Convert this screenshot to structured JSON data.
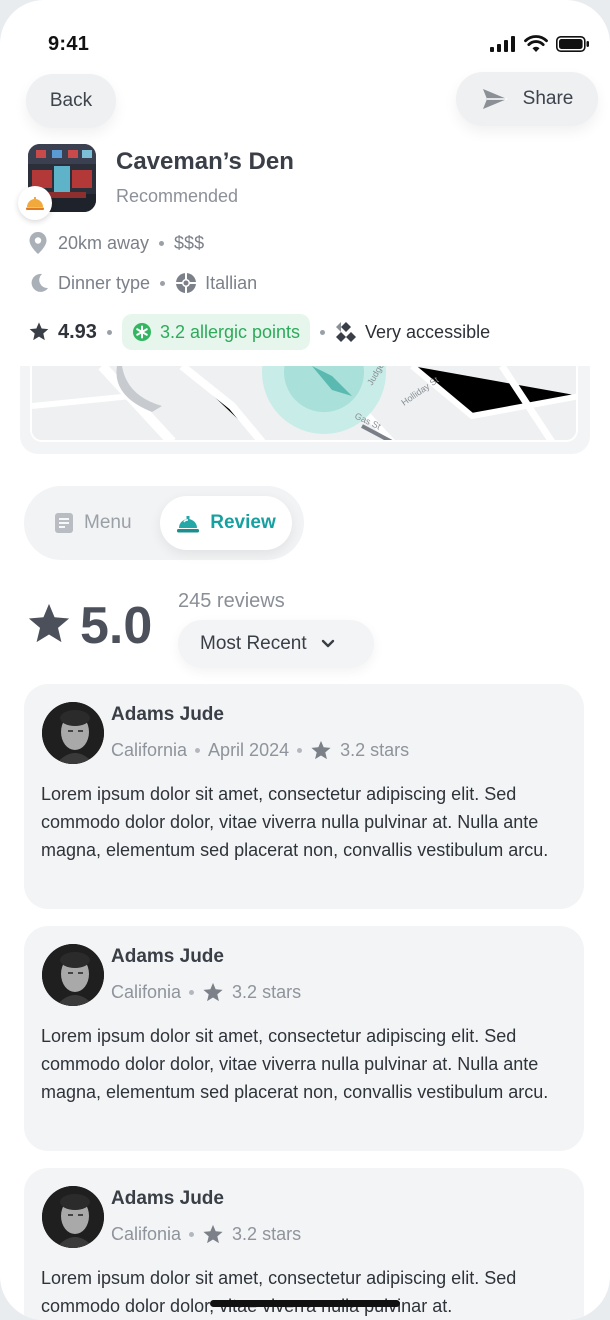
{
  "status_bar": {
    "time": "9:41"
  },
  "header": {
    "back_label": "Back",
    "share_label": "Share"
  },
  "restaurant": {
    "name": "Caveman’s Den",
    "tag": "Recommended",
    "distance": "20km away",
    "price": "$$$",
    "meal_type": "Dinner type",
    "cuisine": "Itallian",
    "rating": "4.93",
    "allergic_points": "3.2 allergic points",
    "accessibility": "Very accessible"
  },
  "map_labels": [
    "Gas St",
    "Holliday St",
    "Judge St"
  ],
  "tabs": {
    "menu_label": "Menu",
    "review_label": "Review",
    "active": "Review"
  },
  "summary": {
    "score": "5.0",
    "count": "245 reviews",
    "sort_label": "Most Recent"
  },
  "reviews": [
    {
      "name": "Adams Jude",
      "location": "California",
      "date": "April 2024",
      "stars": "3.2 stars",
      "text": "Lorem ipsum dolor sit amet, consectetur adipiscing elit. Sed commodo dolor dolor, vitae viverra nulla pulvinar at. Nulla ante magna, elementum sed placerat non, convallis vestibulum arcu."
    },
    {
      "name": "Adams Jude",
      "location": "Califonia",
      "stars": "3.2 stars",
      "text": "Lorem ipsum dolor sit amet, consectetur adipiscing elit. Sed commodo dolor dolor, vitae viverra nulla pulvinar at. Nulla ante magna, elementum sed placerat non, convallis vestibulum arcu."
    },
    {
      "name": "Adams Jude",
      "location": "Califonia",
      "stars": "3.2 stars",
      "text": "Lorem ipsum dolor sit amet, consectetur adipiscing elit. Sed commodo dolor dolor, vitae viverra nulla pulvinar at."
    }
  ],
  "colors": {
    "accent_teal": "#17a0a0",
    "allergy_green": "#2eaa5b",
    "card_bg": "#f3f4f5"
  },
  "icons": [
    "signal-icon",
    "wifi-icon",
    "battery-icon",
    "share-send-icon",
    "location-pin-icon",
    "moon-icon",
    "cuisine-icon",
    "star-icon",
    "allergy-icon",
    "accessibility-icon",
    "menu-doc-icon",
    "review-bell-icon",
    "chevron-down-icon"
  ]
}
